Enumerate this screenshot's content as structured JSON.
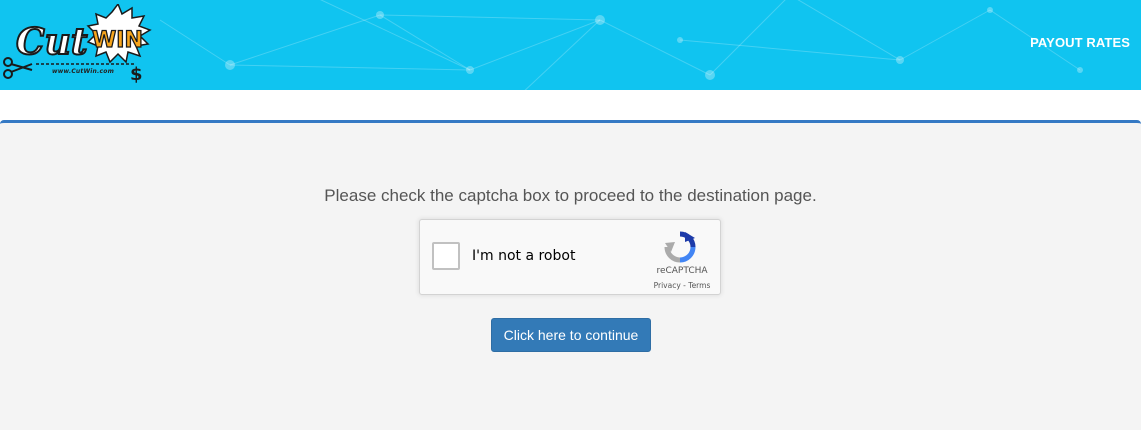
{
  "header": {
    "logo_text": "CutWIN",
    "logo_url": "www.CutWin.com",
    "nav": {
      "payout_rates": "PAYOUT RATES"
    }
  },
  "main": {
    "message": "Please check the captcha box to proceed to the destination page.",
    "continue_button": "Click here to continue"
  },
  "captcha": {
    "label": "I'm not a robot",
    "brand": "reCAPTCHA",
    "privacy": "Privacy",
    "separator": " - ",
    "terms": "Terms",
    "checked": false
  },
  "colors": {
    "header_bg": "#10c4f0",
    "panel_bg": "#f4f4f4",
    "panel_border": "#3579c4",
    "button_bg": "#337ab7"
  }
}
